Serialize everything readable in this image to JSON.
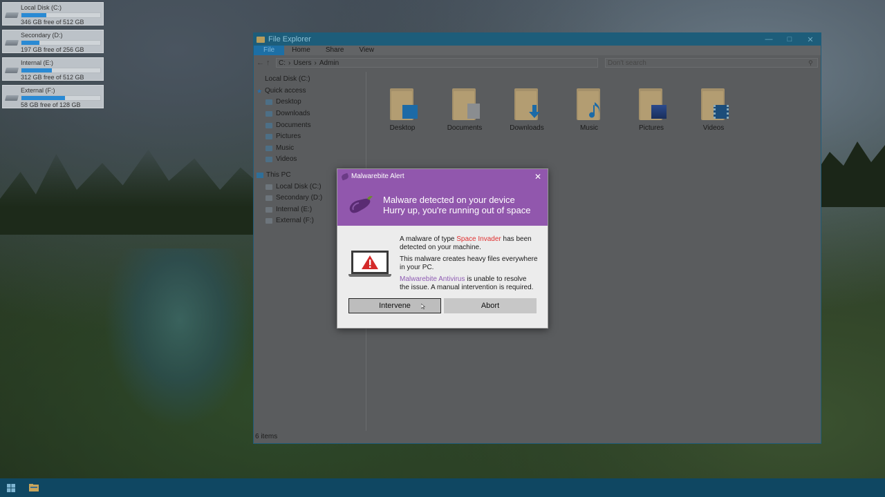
{
  "desktop": {
    "drives": [
      {
        "name": "Local Disk (C:)",
        "free_text": "346 GB free of 512 GB",
        "used_fraction": 0.32
      },
      {
        "name": "Secondary (D:)",
        "free_text": "197 GB free of 256 GB",
        "used_fraction": 0.23
      },
      {
        "name": "Internal (E:)",
        "free_text": "312 GB free of 512 GB",
        "used_fraction": 0.39
      },
      {
        "name": "External (F:)",
        "free_text": "58 GB free of 128 GB",
        "used_fraction": 0.55
      }
    ]
  },
  "explorer": {
    "title": "File Explorer",
    "ribbon_tabs": [
      "File",
      "Home",
      "Share",
      "View"
    ],
    "address": {
      "drive": "C:",
      "seg1": "Users",
      "seg2": "Admin"
    },
    "search_placeholder": "Don't search",
    "nav": {
      "local_disk": "Local Disk (C:)",
      "quick_access": "Quick access",
      "quick_items": [
        "Desktop",
        "Downloads",
        "Documents",
        "Pictures",
        "Music",
        "Videos"
      ],
      "this_pc": "This PC",
      "pc_items": [
        "Local Disk (C:)",
        "Secondary (D:)",
        "Internal (E:)",
        "External (F:)"
      ]
    },
    "folders": [
      "Desktop",
      "Documents",
      "Downloads",
      "Music",
      "Pictures",
      "Videos"
    ],
    "status": "6 items"
  },
  "dialog": {
    "title": "Malwarebite Alert",
    "header_line1": "Malware detected on your device",
    "header_line2": "Hurry up, you're running out of space",
    "msg1_pre": "A malware of type ",
    "msg1_highlight": "Space Invader",
    "msg1_post": " has been detected on your machine.",
    "msg2": "This malware creates heavy files everywhere in your PC.",
    "msg3_highlight": "Malwarebite Antivirus",
    "msg3_post": " is unable to resolve the issue. A manual intervention is required.",
    "btn_intervene": "Intervene",
    "btn_abort": "Abort",
    "colors": {
      "accent": "#9157ad",
      "danger": "#e03030",
      "link": "#8e5bb3"
    }
  },
  "taskbar": {
    "color": "#0f4762"
  }
}
